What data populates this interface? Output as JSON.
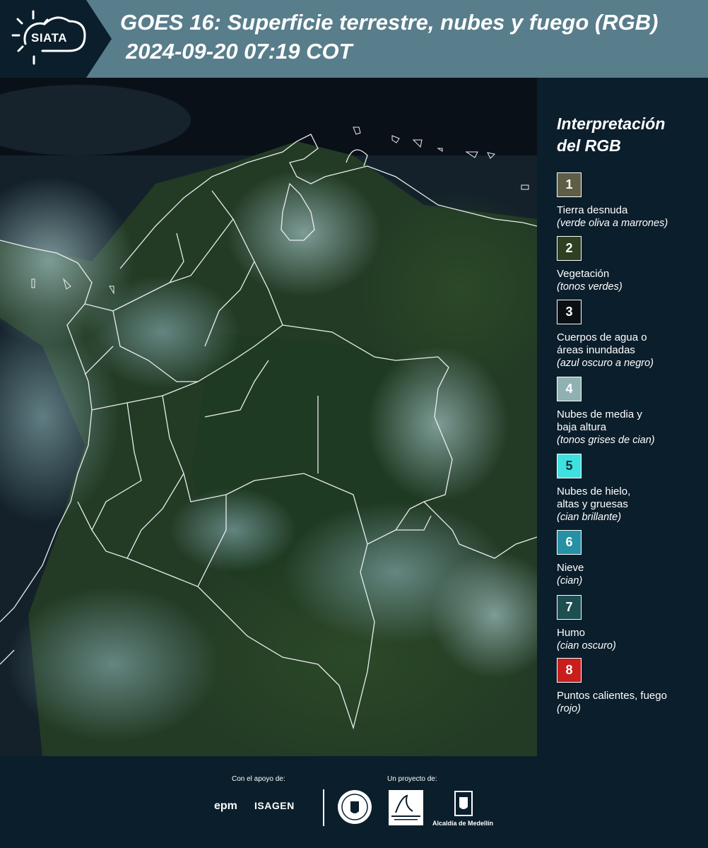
{
  "header": {
    "logo": "SIATA",
    "title_line1": "GOES 16: Superficie terrestre, nubes y fuego (RGB)",
    "title_line2": "2024-09-20 07:19 COT"
  },
  "legend": {
    "title_line1": "Interpretación",
    "title_line2": "del RGB",
    "items": [
      {
        "num": "1",
        "color": "#5d5e45",
        "name": "Tierra desnuda",
        "desc": "(verde oliva a marrones)"
      },
      {
        "num": "2",
        "color": "#2e3f22",
        "name": "Vegetación",
        "desc": "(tonos verdes)"
      },
      {
        "num": "3",
        "color": "#0a0f14",
        "name": "Cuerpos de agua o\náreas inundadas",
        "desc": "(azul oscuro a negro)"
      },
      {
        "num": "4",
        "color": "#8fb1b1",
        "name": "Nubes de media y\nbaja altura",
        "desc": "(tonos grises de cian)"
      },
      {
        "num": "5",
        "color": "#3fe0e0",
        "name": "Nubes de hielo,\naltas y gruesas",
        "desc": "(cian brillante)"
      },
      {
        "num": "6",
        "color": "#2690a4",
        "name": "Nieve",
        "desc": "(cian)"
      },
      {
        "num": "7",
        "color": "#1d4e50",
        "name": "Humo",
        "desc": "(cian oscuro)"
      },
      {
        "num": "8",
        "color": "#c81e1e",
        "name": "Puntos calientes, fuego",
        "desc": "(rojo)"
      }
    ]
  },
  "footer": {
    "support_label": "Con el apoyo de:",
    "project_label": "Un proyecto de:",
    "epm": "epm",
    "isagen": "ISAGEN",
    "area_logo": "Área Metropolitana Valle de Aburrá",
    "alcaldia": "Alcaldía de Medellín"
  }
}
